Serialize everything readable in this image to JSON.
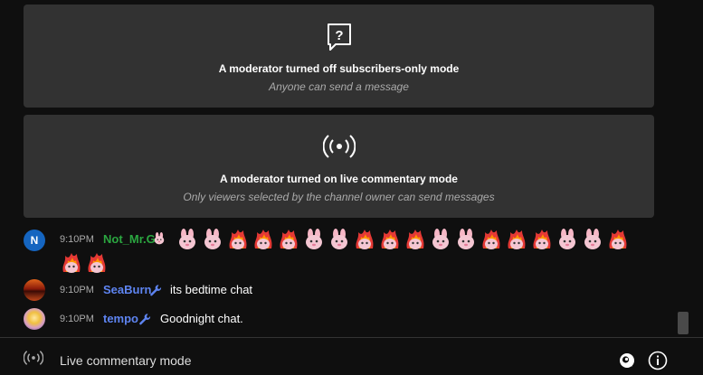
{
  "notices": [
    {
      "icon": "question-bubble-icon",
      "title": "A moderator turned off subscribers-only mode",
      "subtitle": "Anyone can send a message"
    },
    {
      "icon": "broadcast-icon",
      "title": "A moderator turned on live commentary mode",
      "subtitle": "Only viewers selected by the channel owner can send messages"
    }
  ],
  "messages": [
    {
      "time": "9:10PM",
      "author": "Not_Mr.G",
      "author_color": "#2ba640",
      "avatar_letter": "N",
      "badge": "bunny-badge",
      "emojis": [
        "bunny-emoji",
        "bunny-emoji",
        "fire-bunny-emoji",
        "fire-bunny-emoji",
        "fire-bunny-emoji",
        "bunny-emoji",
        "bunny-emoji",
        "fire-bunny-emoji",
        "fire-bunny-emoji",
        "fire-bunny-emoji",
        "bunny-emoji",
        "bunny-emoji",
        "fire-bunny-emoji",
        "fire-bunny-emoji",
        "fire-bunny-emoji",
        "bunny-emoji",
        "bunny-emoji",
        "fire-bunny-emoji",
        "fire-bunny-emoji",
        "fire-bunny-emoji"
      ]
    },
    {
      "time": "9:10PM",
      "author": "SeaBurn",
      "author_color": "#5e84f1",
      "badge": "wrench-icon",
      "text": "its bedtime chat"
    },
    {
      "time": "9:10PM",
      "author": "tempo",
      "author_color": "#5e84f1",
      "badge": "wrench-icon",
      "text": "Goodnight chat."
    }
  ],
  "footer": {
    "mode_label": "Live commentary mode"
  },
  "colors": {
    "background": "#0f0f0f",
    "card": "#323232",
    "moderator_blue": "#5e84f1",
    "member_green": "#2ba640"
  }
}
